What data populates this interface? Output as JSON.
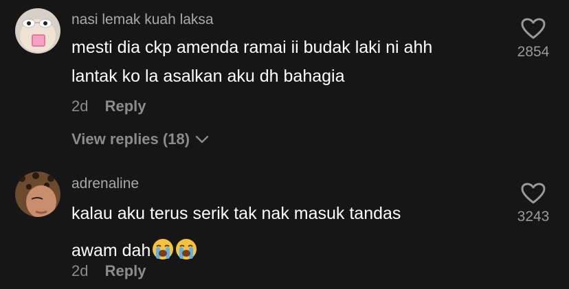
{
  "comments": [
    {
      "username": "nasi lemak kuah laksa",
      "text_line1": "mesti dia ckp amenda ramai ii budak laki ni ahh",
      "text_line2": "lantak ko la asalkan aku dh bahagia",
      "age": "2d",
      "reply_label": "Reply",
      "likes": "2854",
      "view_replies": "View replies (18)",
      "avatar_icon": "hamster-with-sunglasses-avatar"
    },
    {
      "username": "adrenaline",
      "text_line1": "kalau aku terus serik tak nak masuk tandas",
      "text_line2": "awam dah",
      "emojis": [
        "loudly-crying-face-emoji",
        "loudly-crying-face-emoji"
      ],
      "age": "2d",
      "reply_label": "Reply",
      "likes": "3243",
      "avatar_icon": "woman-leopard-headscarf-avatar"
    }
  ],
  "colors": {
    "background": "#161616",
    "username": "#a9a9a9",
    "text": "#ffffff",
    "meta": "#8c8c8c"
  }
}
